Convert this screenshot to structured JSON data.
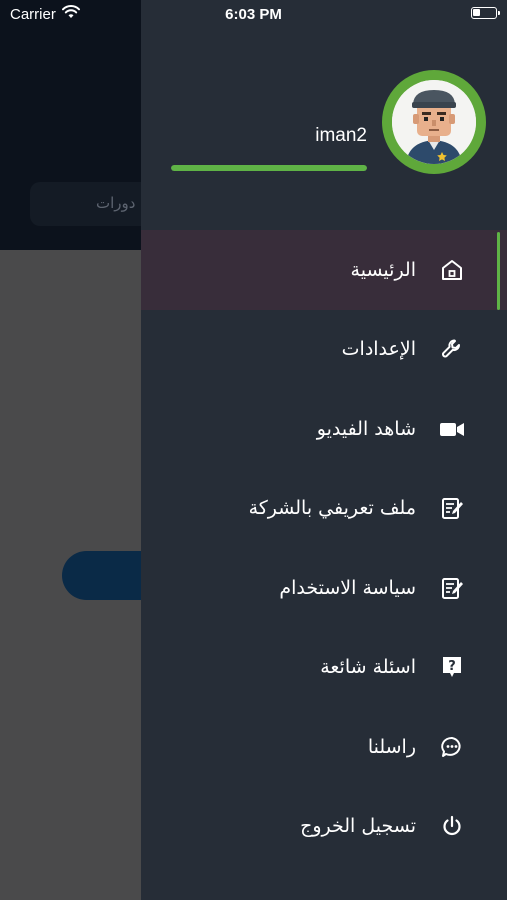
{
  "status_bar": {
    "carrier": "Carrier",
    "time": "6:03 PM"
  },
  "background": {
    "search_text": "دورات"
  },
  "drawer": {
    "profile": {
      "username": "iman2",
      "progress_fraction": 1.0,
      "accent_color": "#5fb346"
    },
    "menu": [
      {
        "label": "الرئيسية",
        "icon": "home-icon",
        "active": true
      },
      {
        "label": "الإعدادات",
        "icon": "wrench-icon",
        "active": false
      },
      {
        "label": "شاهد الفيديو",
        "icon": "video-camera-icon",
        "active": false
      },
      {
        "label": "ملف تعريفي بالشركة",
        "icon": "edit-document-icon",
        "active": false
      },
      {
        "label": "سياسة الاستخدام",
        "icon": "edit-document-icon",
        "active": false
      },
      {
        "label": "اسئلة شائعة",
        "icon": "question-icon",
        "active": false
      },
      {
        "label": "راسلنا",
        "icon": "chat-bubble-icon",
        "active": false
      },
      {
        "label": "تسجيل الخروج",
        "icon": "power-icon",
        "active": false
      }
    ]
  }
}
